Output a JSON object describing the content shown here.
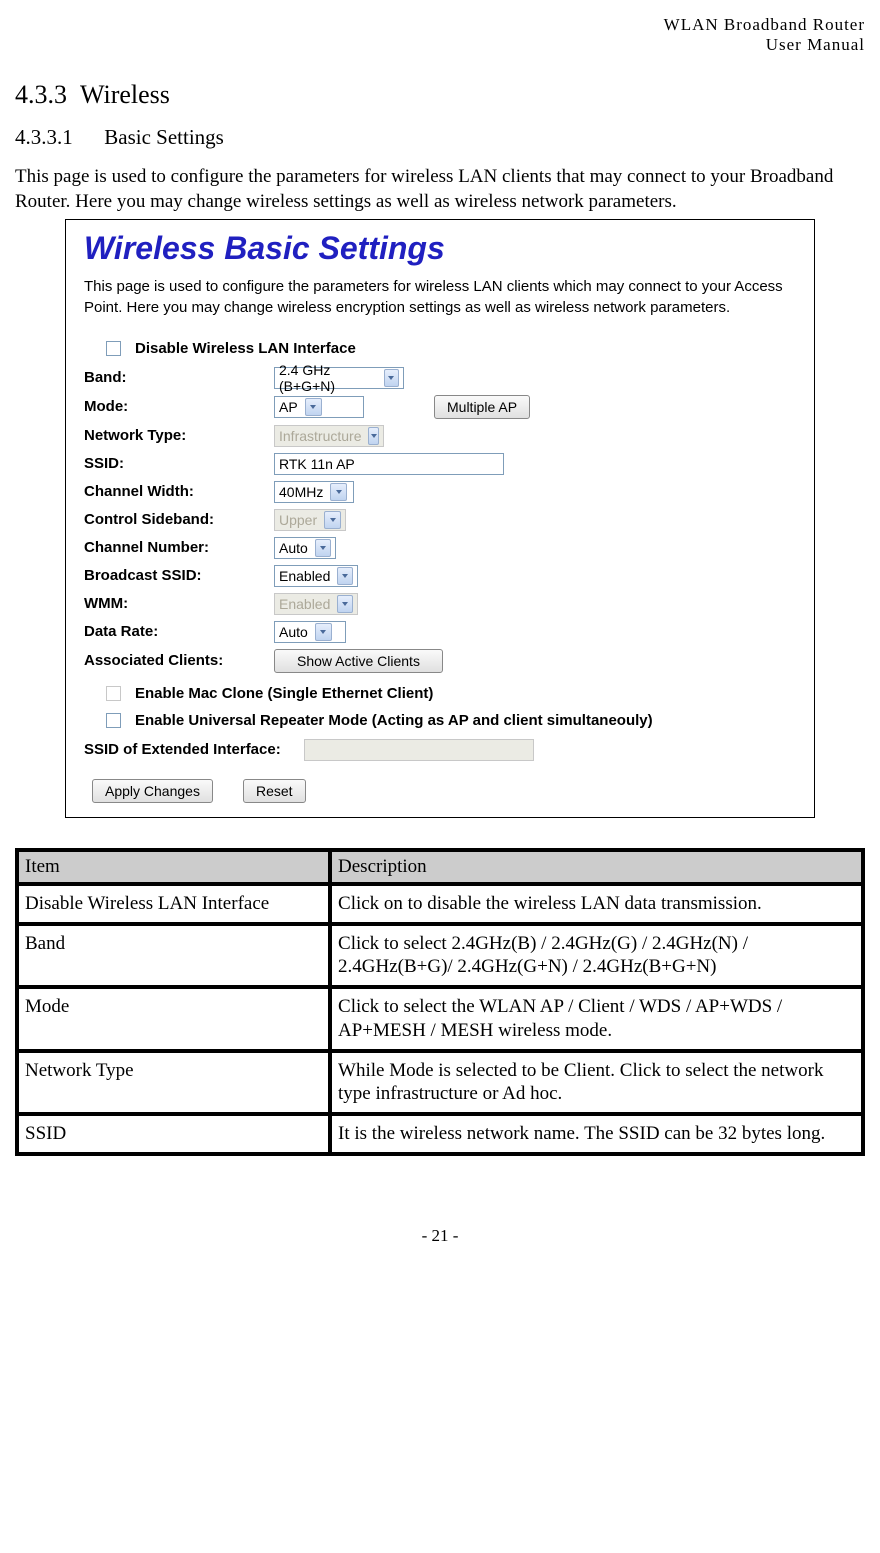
{
  "header": {
    "line1": "WLAN  Broadband  Router",
    "line2": "User  Manual"
  },
  "section": {
    "num": "4.3.3",
    "title": "Wireless"
  },
  "subsection": {
    "num": "4.3.3.1",
    "title": "Basic Settings"
  },
  "intro": "This page is used to configure the parameters for wireless LAN clients that may connect to your Broadband Router. Here you may change wireless settings as well as wireless network parameters.",
  "shot": {
    "title": "Wireless Basic Settings",
    "desc": "This page is used to configure the parameters for wireless LAN clients which may connect to your Access Point. Here you may change wireless encryption settings as well as wireless network parameters.",
    "disable_label": "Disable Wireless LAN Interface",
    "fields": {
      "band": {
        "label": "Band:",
        "value": "2.4 GHz (B+G+N)"
      },
      "mode": {
        "label": "Mode:",
        "value": "AP",
        "multi_btn": "Multiple AP"
      },
      "nettype": {
        "label": "Network Type:",
        "value": "Infrastructure",
        "disabled": true
      },
      "ssid": {
        "label": "SSID:",
        "value": "RTK 11n AP"
      },
      "chwidth": {
        "label": "Channel Width:",
        "value": "40MHz"
      },
      "sideband": {
        "label": "Control Sideband:",
        "value": "Upper",
        "disabled": true
      },
      "chnum": {
        "label": "Channel Number:",
        "value": "Auto"
      },
      "bssid": {
        "label": "Broadcast SSID:",
        "value": "Enabled"
      },
      "wmm": {
        "label": "WMM:",
        "value": "Enabled",
        "disabled": true
      },
      "datarate": {
        "label": "Data Rate:",
        "value": "Auto"
      },
      "assoc": {
        "label": "Associated Clients:",
        "btn": "Show Active Clients"
      },
      "macclone": "Enable Mac Clone (Single Ethernet Client)",
      "urepeater": "Enable Universal Repeater Mode (Acting as AP and client simultaneouly)",
      "extssid": {
        "label": "SSID of Extended Interface:",
        "value": ""
      }
    },
    "buttons": {
      "apply": "Apply Changes",
      "reset": "Reset"
    }
  },
  "table": {
    "head": {
      "item": "Item",
      "desc": "Description"
    },
    "rows": [
      {
        "item": "Disable Wireless LAN Interface",
        "desc": "Click on to disable the wireless LAN data transmission."
      },
      {
        "item": "Band",
        "desc": "Click to select 2.4GHz(B) / 2.4GHz(G) / 2.4GHz(N) / 2.4GHz(B+G)/ 2.4GHz(G+N) / 2.4GHz(B+G+N)"
      },
      {
        "item": "Mode",
        "desc": "Click to select the WLAN AP / Client / WDS / AP+WDS / AP+MESH / MESH wireless mode."
      },
      {
        "item": "Network Type",
        "desc": "While Mode is selected to be Client. Click to select the network type infrastructure or Ad hoc."
      },
      {
        "item": "SSID",
        "desc": "It is the wireless network name. The SSID can be 32 bytes long."
      }
    ]
  },
  "footer": "- 21 -"
}
